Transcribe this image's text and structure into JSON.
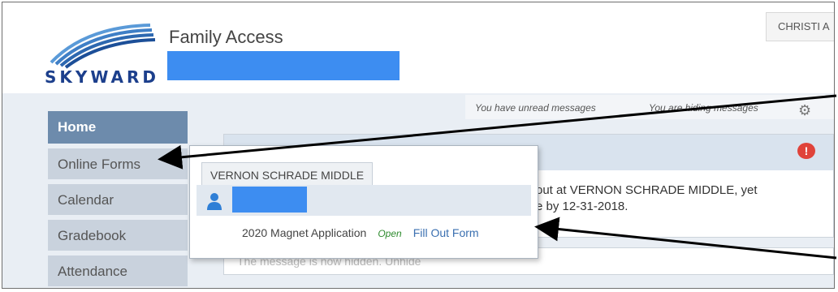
{
  "header": {
    "brand": "SKYWARD",
    "app_title": "Family Access",
    "user_button": "CHRISTI A"
  },
  "topbar": {
    "unread_messages": "You have unread messages",
    "hiding_messages": "You are hiding messages"
  },
  "sidebar": {
    "items": [
      {
        "label": "Home"
      },
      {
        "label": "Online Forms"
      },
      {
        "label": "Calendar"
      },
      {
        "label": "Gradebook"
      },
      {
        "label": "Attendance"
      }
    ]
  },
  "message_panel": {
    "line1": "out at VERNON SCHRADE MIDDLE, yet",
    "line2": "e by 12-31-2018.",
    "footer_text": "The message is now hidden.  Unhide"
  },
  "forms_popup": {
    "school_tab": "VERNON SCHRADE MIDDLE",
    "form_name": "2020 Magnet Application",
    "form_status": "Open",
    "form_action": "Fill Out Form"
  },
  "colors": {
    "brand_blue": "#1c3f8c",
    "redaction": "#3d8df1",
    "active_nav": "#6d8bac",
    "status_open": "#2e8b2e",
    "link": "#3a6fb0",
    "alert": "#e0433a"
  }
}
